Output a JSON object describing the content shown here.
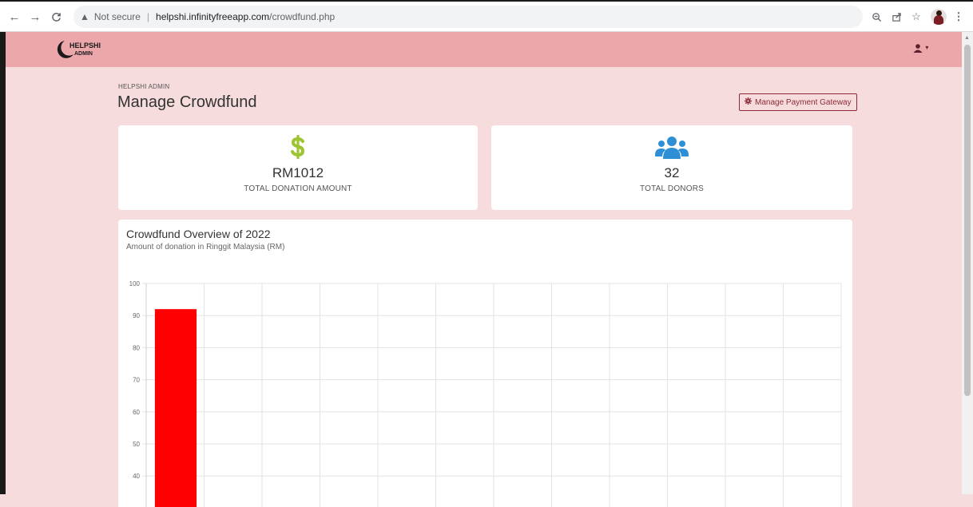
{
  "browser": {
    "security_label": "Not secure",
    "url_host": "helpshi.infinityfreeapp.com",
    "url_path": "/crowdfund.php",
    "icons": [
      "back-icon",
      "forward-icon",
      "reload-icon",
      "warning-icon",
      "zoom-icon",
      "share-icon",
      "bookmark-star-icon",
      "profile-avatar",
      "kebab-menu-icon"
    ]
  },
  "header": {
    "logo_text_top": "HELPSHI",
    "logo_text_bottom": "ADMIN",
    "user_icon": "user-icon",
    "user_caret": "▾"
  },
  "page": {
    "breadcrumb": "HELPSHI ADMIN",
    "title": "Manage Crowdfund",
    "gateway_button": "Manage Payment Gateway",
    "gateway_icon": "gear-icon"
  },
  "stats": {
    "donation": {
      "icon": "dollar-icon",
      "value": "RM1012",
      "label": "TOTAL DONATION AMOUNT",
      "color": "#9dc431"
    },
    "donors": {
      "icon": "users-icon",
      "value": "32",
      "label": "TOTAL DONORS",
      "color": "#2f8fd6"
    }
  },
  "chart": {
    "title": "Crowdfund Overview of 2022",
    "subtitle": "Amount of donation in Ringgit Malaysia (RM)"
  },
  "chart_data": {
    "type": "bar",
    "categories": [
      "",
      "",
      "",
      "",
      "",
      "",
      "",
      "",
      "",
      "",
      "",
      ""
    ],
    "series": [
      {
        "values": [
          92,
          null,
          null,
          null,
          null,
          null,
          null,
          null,
          null,
          null,
          null,
          null
        ],
        "color": "#ff0000"
      }
    ],
    "yticks": [
      40,
      50,
      60,
      70,
      80,
      90,
      100
    ],
    "ylim": [
      35,
      100
    ],
    "grid": true
  },
  "colors": {
    "header": "#eca7ab",
    "page_bg": "#f6dcdc",
    "accent": "#8b2a3a"
  }
}
